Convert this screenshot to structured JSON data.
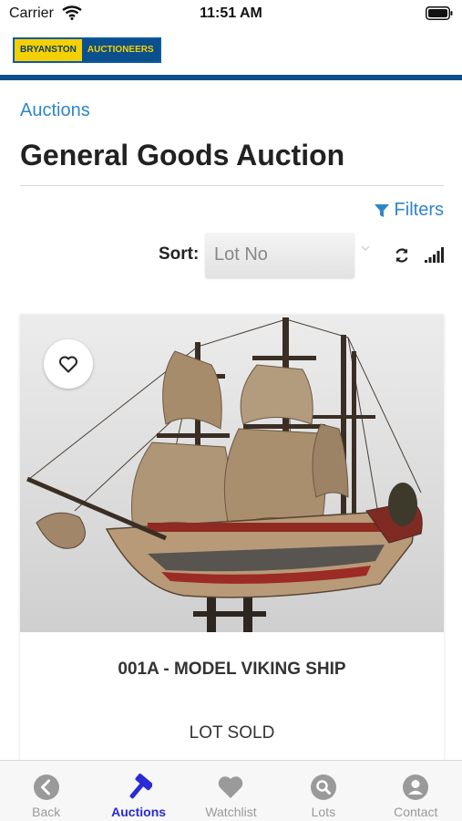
{
  "status_bar": {
    "carrier": "Carrier",
    "time": "11:51 AM"
  },
  "header": {
    "logo_left": "BRYANSTON",
    "logo_right": "AUCTIONEERS"
  },
  "breadcrumb": "Auctions",
  "page_title": "General Goods Auction",
  "filters_label": "Filters",
  "sort": {
    "label": "Sort:",
    "value": "Lot No"
  },
  "lot": {
    "title": "001A - MODEL VIKING SHIP",
    "status": "LOT SOLD"
  },
  "tabs": [
    {
      "label": "Back",
      "icon": "back-icon"
    },
    {
      "label": "Auctions",
      "icon": "hammer-icon",
      "active": true
    },
    {
      "label": "Watchlist",
      "icon": "heart-icon"
    },
    {
      "label": "Lots",
      "icon": "search-icon"
    },
    {
      "label": "Contact",
      "icon": "user-icon"
    }
  ],
  "colors": {
    "brand_blue": "#0b4f8c",
    "brand_yellow": "#f4d000",
    "link": "#2e86c9",
    "active_tab": "#2a2bd6"
  }
}
